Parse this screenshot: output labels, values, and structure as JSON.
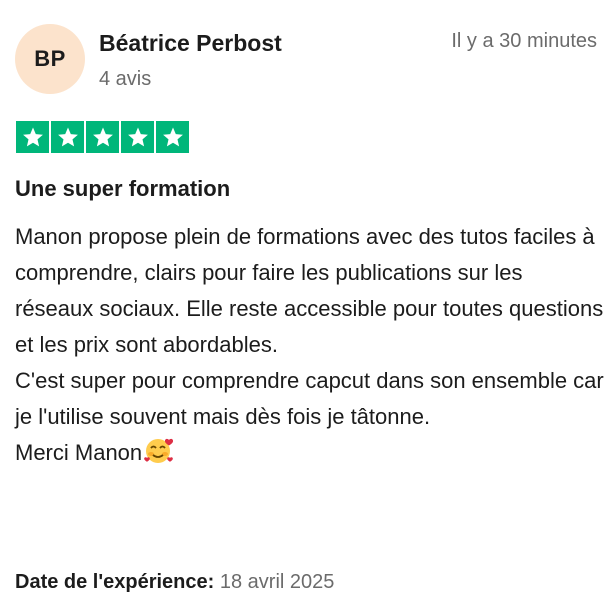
{
  "reviewer": {
    "initials": "BP",
    "name": "Béatrice Perbost",
    "review_count": "4 avis",
    "avatar_color": "#fce3cc"
  },
  "time_ago": "Il y a 30 minutes",
  "rating": {
    "stars": 5,
    "max": 5,
    "star_color": "#00b67a"
  },
  "review": {
    "title": "Une super formation",
    "paragraphs": [
      "Manon propose plein de formations avec des tutos faciles à comprendre, clairs pour faire les publications sur les réseaux sociaux. Elle reste accessible pour toutes questions et les prix sont abordables.",
      "C'est super pour comprendre capcut dans son ensemble car je l'utilise souvent mais dès fois je tâtonne.",
      "Merci Manon"
    ],
    "closing_emoji": "smiling-face-with-hearts-icon"
  },
  "experience": {
    "label": "Date de l'expérience:",
    "date": "18 avril 2025"
  }
}
